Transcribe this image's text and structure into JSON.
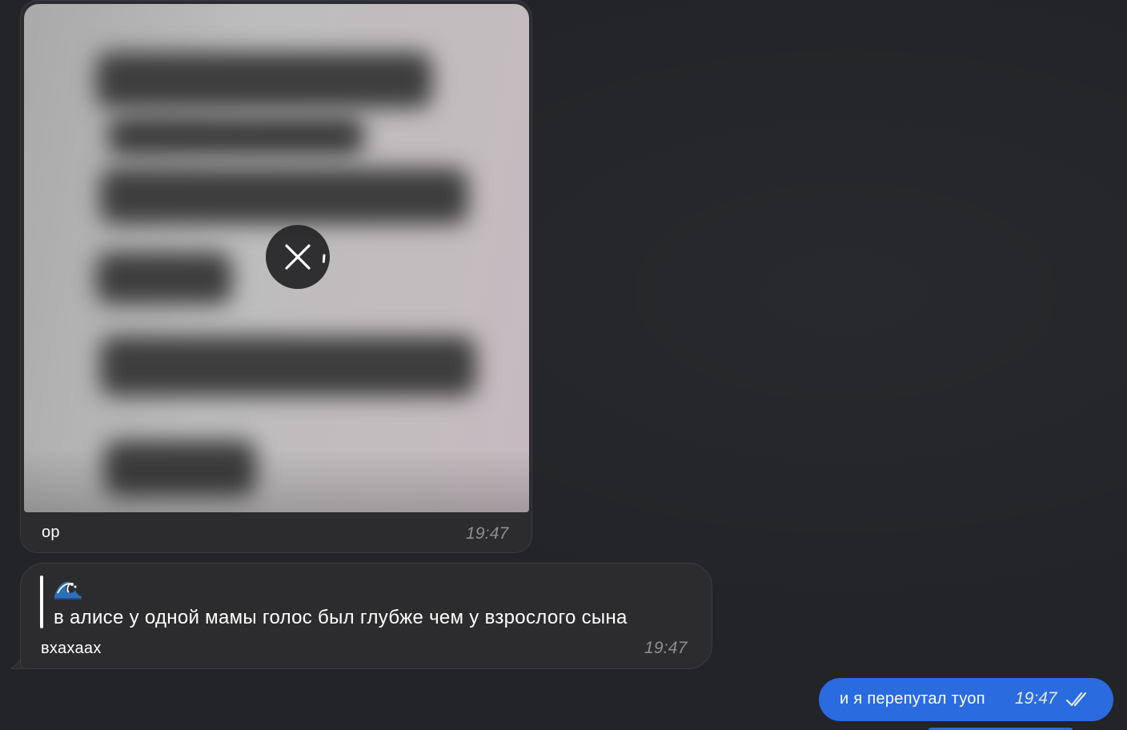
{
  "messages": {
    "photo": {
      "caption": "ор",
      "time": "19:47",
      "download_state": "cancel-download-icon"
    },
    "quote": {
      "quoted_emoji": "water-wave-emoji",
      "quoted_text": "в алисе у одной мамы голос был глубже чем у взрослого сына",
      "caption": "вхахаах",
      "time": "19:47"
    },
    "outgoing": {
      "text": "и я перепутал туоп",
      "time": "19:47",
      "status": "double-check-icon"
    }
  },
  "colors": {
    "background": "#222427",
    "incoming_bubble": "#2c2c2e",
    "outgoing_bubble": "#2a6be0",
    "time_text": "#8e8e93"
  }
}
